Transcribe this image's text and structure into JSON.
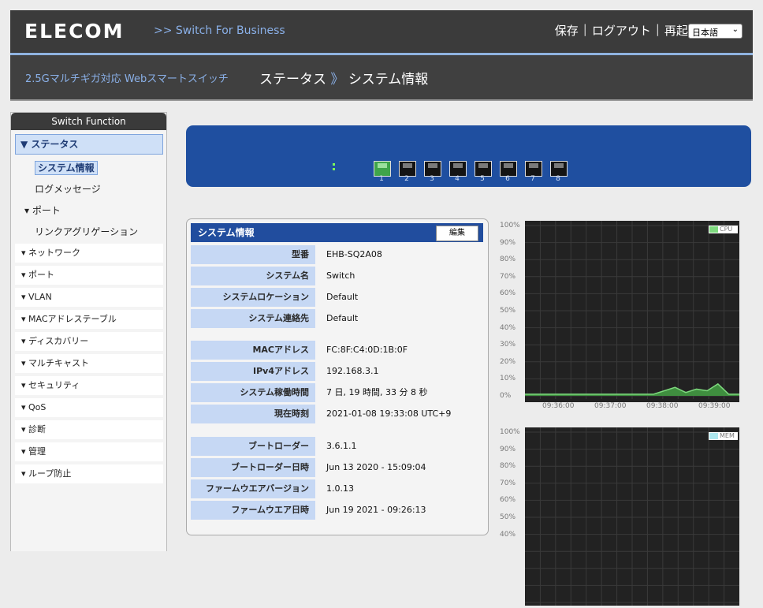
{
  "header": {
    "logo": "ELECOM",
    "brand": ">>  Switch For Business",
    "save": "保存",
    "logout": "ログアウト",
    "reboot": "再起動",
    "separator": "|",
    "language": "日本語",
    "subtitle": "2.5Gマルチギガ対応 Webスマートスイッチ",
    "breadcrumb_section": "ステータス",
    "breadcrumb_arrow": "》",
    "breadcrumb_page": "システム情報"
  },
  "sidebar": {
    "title": "Switch Function",
    "active_group": "▼ ステータス",
    "sub_items": [
      "システム情報",
      "ログメッセージ"
    ],
    "sub_group": "▾  ポート",
    "sub_item_link": "リンクアグリゲーション",
    "items": [
      "▾ ネットワーク",
      "▾ ポート",
      "▾ VLAN",
      "▾ MACアドレステーブル",
      "▾ ディスカバリー",
      "▾ マルチキャスト",
      "▾ セキュリティ",
      "▾ QoS",
      "▾ 診断",
      "▾ 管理",
      "▾ ループ防止"
    ]
  },
  "switch_panel": {
    "ports": [
      "1",
      "2",
      "3",
      "4",
      "5",
      "6",
      "7",
      "8"
    ],
    "link_up": [
      true,
      false,
      false,
      false,
      false,
      false,
      false,
      false
    ],
    "led_color": "#7cff5a"
  },
  "info": {
    "title": "システム情報",
    "edit_label": "編集",
    "rows": [
      {
        "label": "型番",
        "value": "EHB-SQ2A08"
      },
      {
        "label": "システム名",
        "value": "Switch"
      },
      {
        "label": "システムロケーション",
        "value": "Default"
      },
      {
        "label": "システム連絡先",
        "value": "Default"
      },
      {
        "label": "MACアドレス",
        "value": "FC:8F:C4:0D:1B:0F"
      },
      {
        "label": "IPv4アドレス",
        "value": "192.168.3.1"
      },
      {
        "label": "システム稼働時間",
        "value": "7 日, 19 時間, 33 分 8 秒"
      },
      {
        "label": "現在時刻",
        "value": "2021-01-08 19:33:08 UTC+9"
      },
      {
        "label": "ブートローダー",
        "value": "3.6.1.1"
      },
      {
        "label": "ブートローダー日時",
        "value": "Jun 13 2020 - 15:09:04"
      },
      {
        "label": "ファームウエアバージョン",
        "value": "1.0.13"
      },
      {
        "label": "ファームウエア日時",
        "value": "Jun 19 2021 - 09:26:13"
      }
    ]
  },
  "chart_data": [
    {
      "type": "area",
      "title": "",
      "legend": "CPU",
      "legend_color": "#7ed97e",
      "y_ticks": [
        "100%",
        "90%",
        "80%",
        "70%",
        "60%",
        "50%",
        "40%",
        "30%",
        "20%",
        "10%",
        "0%"
      ],
      "ylim": [
        0,
        100
      ],
      "x_ticks": [
        "09:36:00",
        "09:37:00",
        "09:38:00",
        "09:39:00"
      ],
      "x": [
        0,
        0.6,
        0.7,
        0.75,
        0.8,
        0.85,
        0.9,
        0.95,
        1.0
      ],
      "values": [
        1,
        1,
        5,
        2,
        4,
        3,
        7,
        1,
        1
      ]
    },
    {
      "type": "area",
      "title": "",
      "legend": "MEM",
      "legend_color": "#aee7ee",
      "y_ticks": [
        "100%",
        "90%",
        "80%",
        "70%",
        "60%",
        "50%",
        "40%"
      ],
      "ylim": [
        0,
        100
      ]
    }
  ],
  "colors": {
    "accent": "#214d9e",
    "label_bg": "#c6d8f4",
    "header_bg": "#3b3b3b",
    "panel_bg": "#1f4fa0"
  }
}
